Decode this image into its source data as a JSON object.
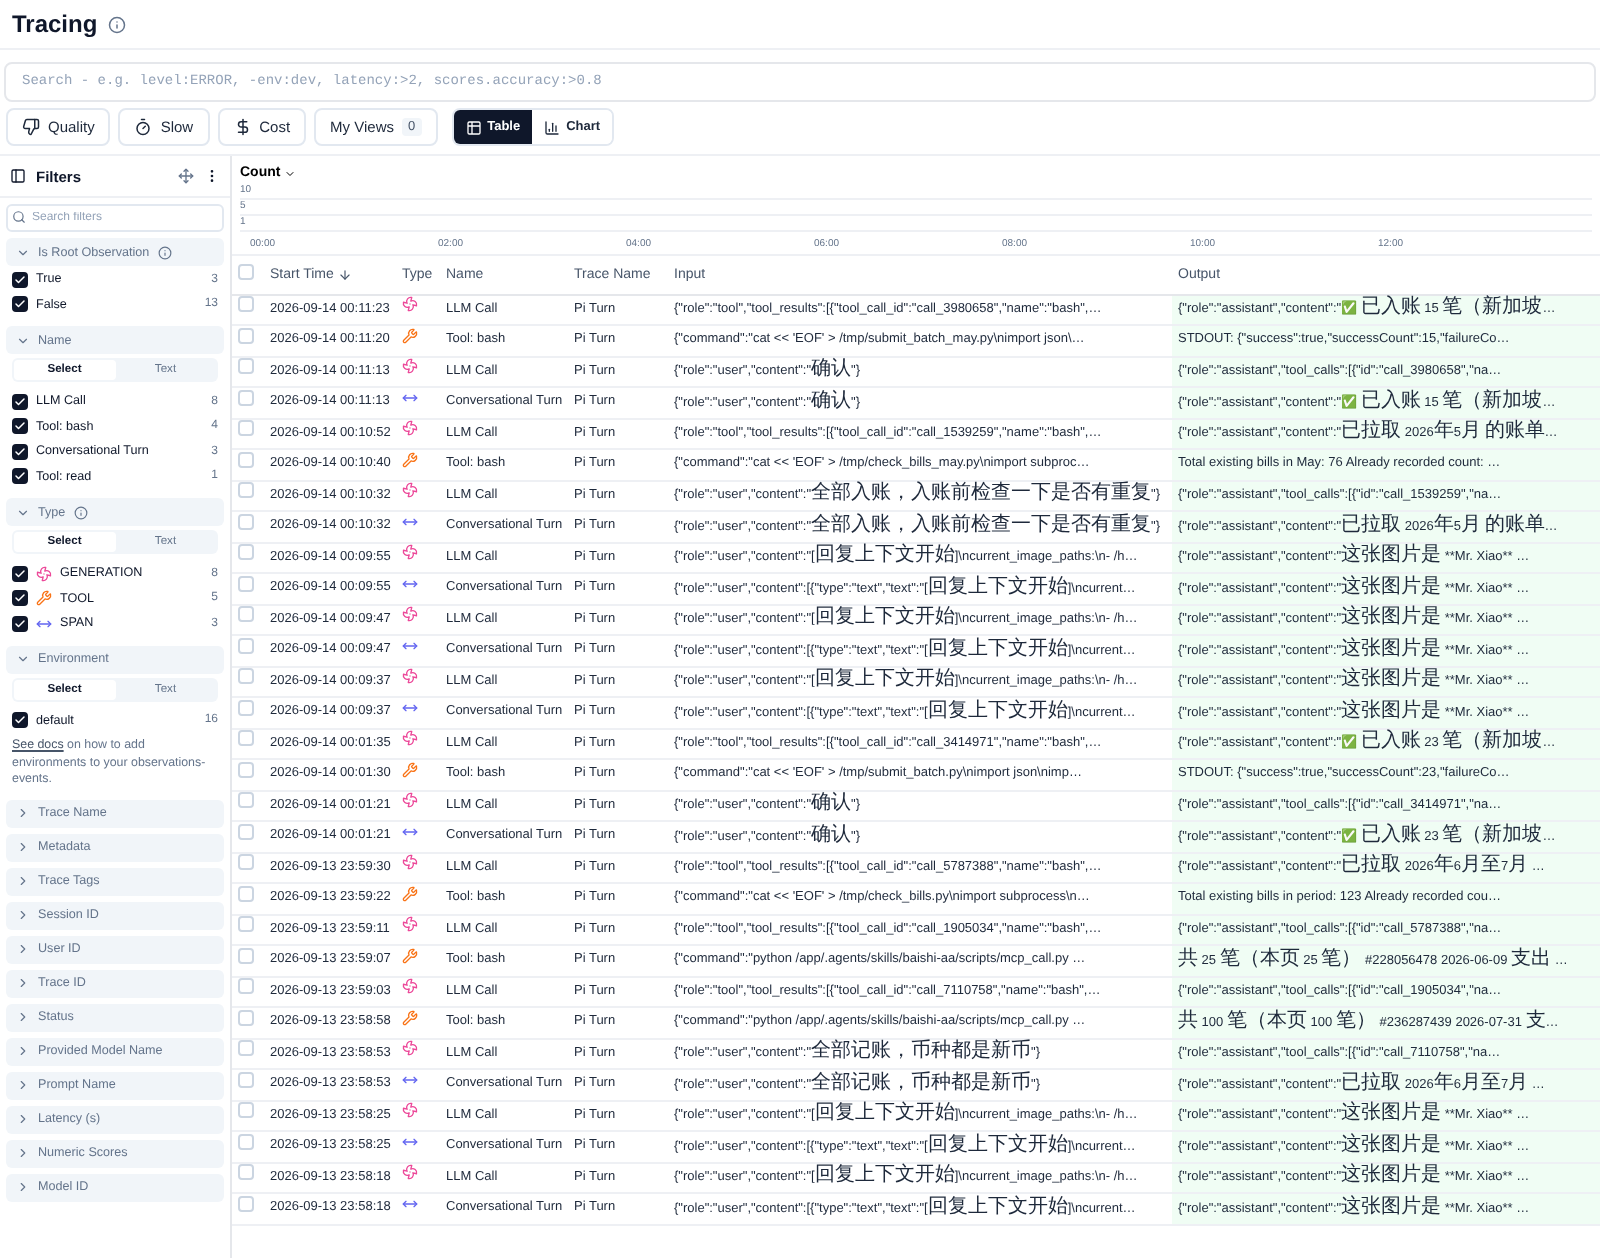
{
  "page": {
    "title": "Tracing"
  },
  "search": {
    "placeholder": "Search - e.g. level:ERROR, -env:dev, latency:>2, scores.accuracy:>0.8"
  },
  "presets": [
    {
      "label": "Quality",
      "kind": "quality"
    },
    {
      "label": "Slow",
      "kind": "slow"
    },
    {
      "label": "Cost",
      "kind": "cost"
    }
  ],
  "views": {
    "label": "My Views",
    "count": "0"
  },
  "view_tabs": [
    {
      "label": "Table",
      "kind": "table",
      "selected": true
    },
    {
      "label": "Chart",
      "kind": "chart",
      "selected": false
    }
  ],
  "filters": {
    "title": "Filters",
    "search_placeholder": "Search filters",
    "sections": [
      {
        "title": "Is Root Observation",
        "info": true,
        "expanded": true,
        "options": [
          {
            "label": "True",
            "count": "3",
            "checked": true
          },
          {
            "label": "False",
            "count": "13",
            "checked": true
          }
        ]
      },
      {
        "title": "Name",
        "expanded": true,
        "modes": [
          {
            "label": "Select",
            "selected": true
          },
          {
            "label": "Text",
            "selected": false
          }
        ],
        "options": [
          {
            "label": "LLM Call",
            "count": "8",
            "checked": true
          },
          {
            "label": "Tool: bash",
            "count": "4",
            "checked": true
          },
          {
            "label": "Conversational Turn",
            "count": "3",
            "checked": true
          },
          {
            "label": "Tool: read",
            "count": "1",
            "checked": true
          }
        ]
      },
      {
        "title": "Type",
        "info": true,
        "expanded": true,
        "modes": [
          {
            "label": "Select",
            "selected": true
          },
          {
            "label": "Text",
            "selected": false
          }
        ],
        "options": [
          {
            "label": "GENERATION",
            "count": "8",
            "checked": true,
            "kind": "generation"
          },
          {
            "label": "TOOL",
            "count": "5",
            "checked": true,
            "kind": "tool"
          },
          {
            "label": "SPAN",
            "count": "3",
            "checked": true,
            "kind": "span"
          }
        ]
      },
      {
        "title": "Environment",
        "expanded": true,
        "modes": [
          {
            "label": "Select",
            "selected": true
          },
          {
            "label": "Text",
            "selected": false
          }
        ],
        "options": [
          {
            "label": "default",
            "count": "16",
            "checked": true
          }
        ],
        "note": {
          "link": "See docs",
          "text": " on how to add environments to your observations-events."
        }
      },
      {
        "title": "Trace Name",
        "expanded": false
      },
      {
        "title": "Metadata",
        "expanded": false
      },
      {
        "title": "Trace Tags",
        "expanded": false
      },
      {
        "title": "Session ID",
        "expanded": false
      },
      {
        "title": "User ID",
        "expanded": false
      },
      {
        "title": "Trace ID",
        "expanded": false
      },
      {
        "title": "Status",
        "expanded": false
      },
      {
        "title": "Provided Model Name",
        "expanded": false
      },
      {
        "title": "Prompt Name",
        "expanded": false
      },
      {
        "title": "Latency (s)",
        "expanded": false
      },
      {
        "title": "Numeric Scores",
        "expanded": false
      },
      {
        "title": "Model ID",
        "expanded": false
      }
    ]
  },
  "chart": {
    "metric": "Count",
    "y_labels": [
      "10",
      "5",
      "1"
    ],
    "x_labels": [
      "00:00",
      "02:00",
      "04:00",
      "06:00",
      "08:00",
      "10:00",
      "12:00"
    ]
  },
  "table": {
    "select_all_checked": false,
    "columns": [
      {
        "label": "Start Time",
        "sorted": true
      },
      {
        "label": "Type"
      },
      {
        "label": "Name"
      },
      {
        "label": "Trace Name"
      },
      {
        "label": "Input"
      },
      {
        "label": "Output"
      }
    ],
    "rows": [
      {
        "checked": false,
        "start": "2026-09-14 00:11:23",
        "kind": "generation",
        "name": "LLM Call",
        "trace": "Pi Turn",
        "input": "{\"role\":\"tool\",\"tool_results\":[{\"tool_call_id\":\"call_3980658\",\"name\":\"bash\",…",
        "output": "{\"role\":\"assistant\",\"content\":\"✅ 已入账 15 笔（新加坡…"
      },
      {
        "checked": false,
        "start": "2026-09-14 00:11:20",
        "kind": "tool",
        "name": "Tool: bash",
        "trace": "Pi Turn",
        "input": "{\"command\":\"cat << 'EOF' > /tmp/submit_batch_may.py\\nimport json\\…",
        "output": "STDOUT: {\"success\":true,\"successCount\":15,\"failureCo…"
      },
      {
        "checked": false,
        "start": "2026-09-14 00:11:13",
        "kind": "generation",
        "name": "LLM Call",
        "trace": "Pi Turn",
        "input": "{\"role\":\"user\",\"content\":\"确认\"}",
        "output": "{\"role\":\"assistant\",\"tool_calls\":[{\"id\":\"call_3980658\",\"na…"
      },
      {
        "checked": false,
        "start": "2026-09-14 00:11:13",
        "kind": "span",
        "name": "Conversational Turn",
        "trace": "Pi Turn",
        "input": "{\"role\":\"user\",\"content\":\"确认\"}",
        "output": "{\"role\":\"assistant\",\"content\":\"✅ 已入账 15 笔（新加坡…"
      },
      {
        "checked": false,
        "start": "2026-09-14 00:10:52",
        "kind": "generation",
        "name": "LLM Call",
        "trace": "Pi Turn",
        "input": "{\"role\":\"tool\",\"tool_results\":[{\"tool_call_id\":\"call_1539259\",\"name\":\"bash\",…",
        "output": "{\"role\":\"assistant\",\"content\":\"已拉取 2026年5月 的账单…"
      },
      {
        "checked": false,
        "start": "2026-09-14 00:10:40",
        "kind": "tool",
        "name": "Tool: bash",
        "trace": "Pi Turn",
        "input": "{\"command\":\"cat << 'EOF' > /tmp/check_bills_may.py\\nimport subproc…",
        "output": "Total existing bills in May: 76 Already recorded count: …"
      },
      {
        "checked": false,
        "start": "2026-09-14 00:10:32",
        "kind": "generation",
        "name": "LLM Call",
        "trace": "Pi Turn",
        "input": "{\"role\":\"user\",\"content\":\"全部入账，入账前检查一下是否有重复\"}",
        "output": "{\"role\":\"assistant\",\"tool_calls\":[{\"id\":\"call_1539259\",\"na…"
      },
      {
        "checked": false,
        "start": "2026-09-14 00:10:32",
        "kind": "span",
        "name": "Conversational Turn",
        "trace": "Pi Turn",
        "input": "{\"role\":\"user\",\"content\":\"全部入账，入账前检查一下是否有重复\"}",
        "output": "{\"role\":\"assistant\",\"content\":\"已拉取 2026年5月 的账单…"
      },
      {
        "checked": false,
        "start": "2026-09-14 00:09:55",
        "kind": "generation",
        "name": "LLM Call",
        "trace": "Pi Turn",
        "input": "{\"role\":\"user\",\"content\":\"[回复上下文开始]\\ncurrent_image_paths:\\n- /h…",
        "output": "{\"role\":\"assistant\",\"content\":\"这张图片是 **Mr. Xiao** …"
      },
      {
        "checked": false,
        "start": "2026-09-14 00:09:55",
        "kind": "span",
        "name": "Conversational Turn",
        "trace": "Pi Turn",
        "input": "{\"role\":\"user\",\"content\":[{\"type\":\"text\",\"text\":\"[回复上下文开始]\\ncurrent…",
        "output": "{\"role\":\"assistant\",\"content\":\"这张图片是 **Mr. Xiao** …"
      },
      {
        "checked": false,
        "start": "2026-09-14 00:09:47",
        "kind": "generation",
        "name": "LLM Call",
        "trace": "Pi Turn",
        "input": "{\"role\":\"user\",\"content\":\"[回复上下文开始]\\ncurrent_image_paths:\\n- /h…",
        "output": "{\"role\":\"assistant\",\"content\":\"这张图片是 **Mr. Xiao** …"
      },
      {
        "checked": false,
        "start": "2026-09-14 00:09:47",
        "kind": "span",
        "name": "Conversational Turn",
        "trace": "Pi Turn",
        "input": "{\"role\":\"user\",\"content\":[{\"type\":\"text\",\"text\":\"[回复上下文开始]\\ncurrent…",
        "output": "{\"role\":\"assistant\",\"content\":\"这张图片是 **Mr. Xiao** …"
      },
      {
        "checked": false,
        "start": "2026-09-14 00:09:37",
        "kind": "generation",
        "name": "LLM Call",
        "trace": "Pi Turn",
        "input": "{\"role\":\"user\",\"content\":\"[回复上下文开始]\\ncurrent_image_paths:\\n- /h…",
        "output": "{\"role\":\"assistant\",\"content\":\"这张图片是 **Mr. Xiao** …"
      },
      {
        "checked": false,
        "start": "2026-09-14 00:09:37",
        "kind": "span",
        "name": "Conversational Turn",
        "trace": "Pi Turn",
        "input": "{\"role\":\"user\",\"content\":[{\"type\":\"text\",\"text\":\"[回复上下文开始]\\ncurrent…",
        "output": "{\"role\":\"assistant\",\"content\":\"这张图片是 **Mr. Xiao** …"
      },
      {
        "checked": false,
        "start": "2026-09-14 00:01:35",
        "kind": "generation",
        "name": "LLM Call",
        "trace": "Pi Turn",
        "input": "{\"role\":\"tool\",\"tool_results\":[{\"tool_call_id\":\"call_3414971\",\"name\":\"bash\",…",
        "output": "{\"role\":\"assistant\",\"content\":\"✅ 已入账 23 笔（新加坡…"
      },
      {
        "checked": false,
        "start": "2026-09-14 00:01:30",
        "kind": "tool",
        "name": "Tool: bash",
        "trace": "Pi Turn",
        "input": "{\"command\":\"cat << 'EOF' > /tmp/submit_batch.py\\nimport json\\nimp…",
        "output": "STDOUT: {\"success\":true,\"successCount\":23,\"failureCo…"
      },
      {
        "checked": false,
        "start": "2026-09-14 00:01:21",
        "kind": "generation",
        "name": "LLM Call",
        "trace": "Pi Turn",
        "input": "{\"role\":\"user\",\"content\":\"确认\"}",
        "output": "{\"role\":\"assistant\",\"tool_calls\":[{\"id\":\"call_3414971\",\"na…"
      },
      {
        "checked": false,
        "start": "2026-09-14 00:01:21",
        "kind": "span",
        "name": "Conversational Turn",
        "trace": "Pi Turn",
        "input": "{\"role\":\"user\",\"content\":\"确认\"}",
        "output": "{\"role\":\"assistant\",\"content\":\"✅ 已入账 23 笔（新加坡…"
      },
      {
        "checked": false,
        "start": "2026-09-13 23:59:30",
        "kind": "generation",
        "name": "LLM Call",
        "trace": "Pi Turn",
        "input": "{\"role\":\"tool\",\"tool_results\":[{\"tool_call_id\":\"call_5787388\",\"name\":\"bash\",…",
        "output": "{\"role\":\"assistant\",\"content\":\"已拉取 2026年6月至7月 …"
      },
      {
        "checked": false,
        "start": "2026-09-13 23:59:22",
        "kind": "tool",
        "name": "Tool: bash",
        "trace": "Pi Turn",
        "input": "{\"command\":\"cat << 'EOF' > /tmp/check_bills.py\\nimport subprocess\\n…",
        "output": "Total existing bills in period: 123 Already recorded cou…"
      },
      {
        "checked": false,
        "start": "2026-09-13 23:59:11",
        "kind": "generation",
        "name": "LLM Call",
        "trace": "Pi Turn",
        "input": "{\"role\":\"tool\",\"tool_results\":[{\"tool_call_id\":\"call_1905034\",\"name\":\"bash\",…",
        "output": "{\"role\":\"assistant\",\"tool_calls\":[{\"id\":\"call_5787388\",\"na…"
      },
      {
        "checked": false,
        "start": "2026-09-13 23:59:07",
        "kind": "tool",
        "name": "Tool: bash",
        "trace": "Pi Turn",
        "input": "{\"command\":\"python /app/.agents/skills/baishi-aa/scripts/mcp_call.py …",
        "output": "共 25 笔（本页 25 笔） #228056478 2026-06-09 支出 …"
      },
      {
        "checked": false,
        "start": "2026-09-13 23:59:03",
        "kind": "generation",
        "name": "LLM Call",
        "trace": "Pi Turn",
        "input": "{\"role\":\"tool\",\"tool_results\":[{\"tool_call_id\":\"call_7110758\",\"name\":\"bash\",…",
        "output": "{\"role\":\"assistant\",\"tool_calls\":[{\"id\":\"call_1905034\",\"na…"
      },
      {
        "checked": false,
        "start": "2026-09-13 23:58:58",
        "kind": "tool",
        "name": "Tool: bash",
        "trace": "Pi Turn",
        "input": "{\"command\":\"python /app/.agents/skills/baishi-aa/scripts/mcp_call.py …",
        "output": "共 100 笔（本页 100 笔） #236287439 2026-07-31 支…"
      },
      {
        "checked": false,
        "start": "2026-09-13 23:58:53",
        "kind": "generation",
        "name": "LLM Call",
        "trace": "Pi Turn",
        "input": "{\"role\":\"user\",\"content\":\"全部记账，币种都是新币\"}",
        "output": "{\"role\":\"assistant\",\"tool_calls\":[{\"id\":\"call_7110758\",\"na…"
      },
      {
        "checked": false,
        "start": "2026-09-13 23:58:53",
        "kind": "span",
        "name": "Conversational Turn",
        "trace": "Pi Turn",
        "input": "{\"role\":\"user\",\"content\":\"全部记账，币种都是新币\"}",
        "output": "{\"role\":\"assistant\",\"content\":\"已拉取 2026年6月至7月 …"
      },
      {
        "checked": false,
        "start": "2026-09-13 23:58:25",
        "kind": "generation",
        "name": "LLM Call",
        "trace": "Pi Turn",
        "input": "{\"role\":\"user\",\"content\":\"[回复上下文开始]\\ncurrent_image_paths:\\n- /h…",
        "output": "{\"role\":\"assistant\",\"content\":\"这张图片是 **Mr. Xiao** …"
      },
      {
        "checked": false,
        "start": "2026-09-13 23:58:25",
        "kind": "span",
        "name": "Conversational Turn",
        "trace": "Pi Turn",
        "input": "{\"role\":\"user\",\"content\":[{\"type\":\"text\",\"text\":\"[回复上下文开始]\\ncurrent…",
        "output": "{\"role\":\"assistant\",\"content\":\"这张图片是 **Mr. Xiao** …"
      },
      {
        "checked": false,
        "start": "2026-09-13 23:58:18",
        "kind": "generation",
        "name": "LLM Call",
        "trace": "Pi Turn",
        "input": "{\"role\":\"user\",\"content\":\"[回复上下文开始]\\ncurrent_image_paths:\\n- /h…",
        "output": "{\"role\":\"assistant\",\"content\":\"这张图片是 **Mr. Xiao** …"
      },
      {
        "checked": false,
        "start": "2026-09-13 23:58:18",
        "kind": "span",
        "name": "Conversational Turn",
        "trace": "Pi Turn",
        "input": "{\"role\":\"user\",\"content\":[{\"type\":\"text\",\"text\":\"[回复上下文开始]\\ncurrent…",
        "output": "{\"role\":\"assistant\",\"content\":\"这张图片是 **Mr. Xiao** …"
      }
    ]
  }
}
